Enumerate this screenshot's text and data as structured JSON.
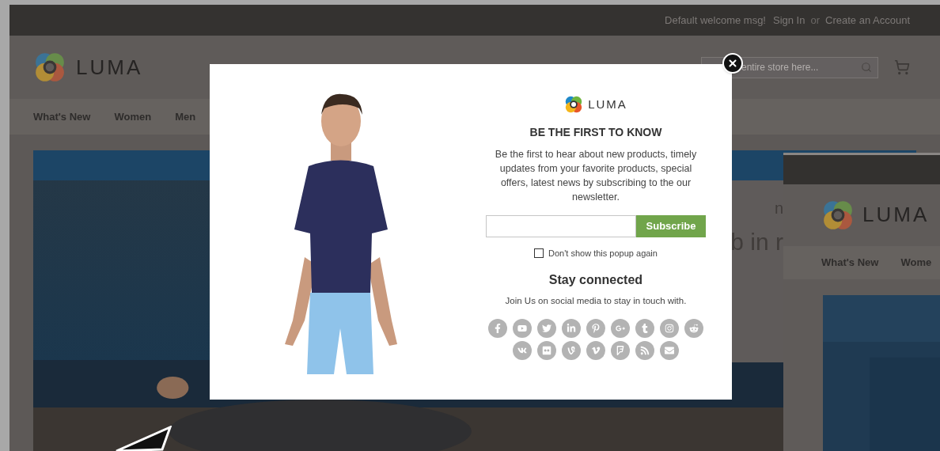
{
  "top_bar": {
    "links": [
      {
        "text": "Default welcome msg!",
        "kind": "text"
      },
      {
        "text": "Sign In",
        "kind": "link"
      },
      {
        "text": "or",
        "kind": "text"
      },
      {
        "text": "Create an Account",
        "kind": "link"
      }
    ]
  },
  "header": {
    "logo": "LUMA",
    "search": {
      "placeholder": "entire store here..."
    }
  },
  "nav": {
    "items": [
      "What's New",
      "Women",
      "Men"
    ]
  },
  "hero": {
    "text_lines": [
      "n",
      "b in r"
    ]
  },
  "popup": {
    "logo": "LUMA",
    "title": "BE THE FIRST TO KNOW",
    "description": "Be the first to hear about new products, timely updates from your favorite products, special offers, latest news by subscribing to the our newsletter.",
    "subscribe_button": "Subscribe",
    "dont_show": {
      "label": "Don't show this popup again",
      "checked": false
    },
    "social_title": "Stay connected",
    "social_text": "Join Us on social media to stay in touch with."
  },
  "second_window": {
    "logo": "LUMA",
    "nav": {
      "items": [
        "What's New",
        "Wome"
      ]
    }
  }
}
